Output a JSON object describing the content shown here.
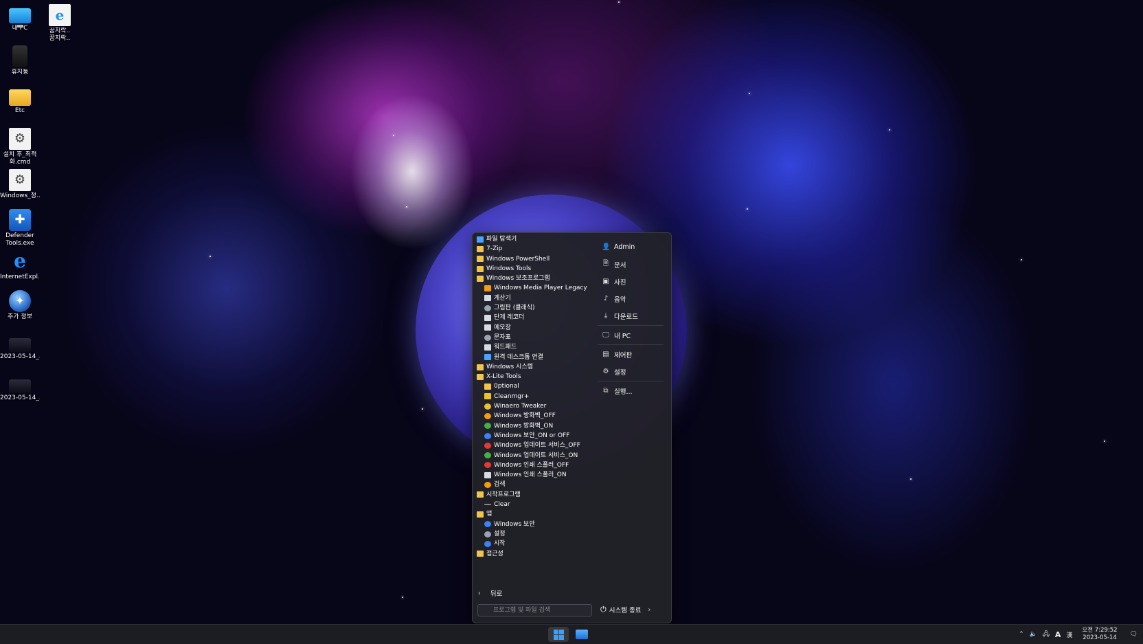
{
  "desktop": {
    "icons": [
      {
        "label": "내 PC",
        "icon": "monitor-icon"
      },
      {
        "label": "꿈지락.. 꿈지락..",
        "icon": "internet-explorer-icon"
      },
      {
        "label": "휴지통",
        "icon": "recycle-bin-icon"
      },
      {
        "label": "Etc",
        "icon": "folder-icon"
      },
      {
        "label": "설치 후_최적화.cmd",
        "icon": "gear-script-icon"
      },
      {
        "label": "Windows_정...",
        "icon": "gear-script-icon"
      },
      {
        "label": "Defender Tools.exe",
        "icon": "shield-icon"
      },
      {
        "label": "InternetExpl...",
        "icon": "internet-explorer-icon"
      },
      {
        "label": "추가 정보",
        "icon": "globe-icon"
      },
      {
        "label": "2023-05-14_...",
        "icon": "video-thumbnail-icon"
      },
      {
        "label": "2023-05-14_...",
        "icon": "video-thumbnail-icon"
      }
    ]
  },
  "start_menu": {
    "programs": [
      {
        "label": "파일 탐색기",
        "level": 0,
        "icon": "file-explorer-icon"
      },
      {
        "label": "7-Zip",
        "level": 0,
        "icon": "folder-icon"
      },
      {
        "label": "Windows PowerShell",
        "level": 0,
        "icon": "folder-icon"
      },
      {
        "label": "Windows Tools",
        "level": 0,
        "icon": "folder-icon"
      },
      {
        "label": "Windows 보조프로그램",
        "level": 0,
        "icon": "folder-icon"
      },
      {
        "label": "Windows Media Player Legacy",
        "level": 1,
        "icon": "media-player-icon"
      },
      {
        "label": "계산기",
        "level": 1,
        "icon": "calculator-icon"
      },
      {
        "label": "그림판 (클래식)",
        "level": 1,
        "icon": "paint-icon"
      },
      {
        "label": "단계 레코더",
        "level": 1,
        "icon": "steps-recorder-icon"
      },
      {
        "label": "메모장",
        "level": 1,
        "icon": "notepad-icon"
      },
      {
        "label": "문자표",
        "level": 1,
        "icon": "character-map-icon"
      },
      {
        "label": "워드패드",
        "level": 1,
        "icon": "wordpad-icon"
      },
      {
        "label": "원격 데스크톱 연결",
        "level": 1,
        "icon": "remote-desktop-icon"
      },
      {
        "label": "Windows 시스템",
        "level": 0,
        "icon": "folder-icon"
      },
      {
        "label": "X-Lite Tools",
        "level": 0,
        "icon": "folder-icon"
      },
      {
        "label": "0ptional",
        "level": 1,
        "icon": "folder-icon"
      },
      {
        "label": "Cleanmgr+",
        "level": 1,
        "icon": "broom-icon"
      },
      {
        "label": "Winaero Tweaker",
        "level": 1,
        "icon": "tweaker-icon"
      },
      {
        "label": "Windows 방화벽_OFF",
        "level": 1,
        "icon": "firewall-off-icon"
      },
      {
        "label": "Windows 방화벽_ON",
        "level": 1,
        "icon": "firewall-on-icon"
      },
      {
        "label": "Windows 보안_ON or OFF",
        "level": 1,
        "icon": "security-toggle-icon"
      },
      {
        "label": "Windows 업데이트 서비스_OFF",
        "level": 1,
        "icon": "update-off-icon"
      },
      {
        "label": "Windows 업데이트 서비스_ON",
        "level": 1,
        "icon": "update-on-icon"
      },
      {
        "label": "Windows 인쇄 스풀러_OFF",
        "level": 1,
        "icon": "spooler-off-icon"
      },
      {
        "label": "Windows 인쇄 스풀러_ON",
        "level": 1,
        "icon": "printer-icon"
      },
      {
        "label": "검색",
        "level": 1,
        "icon": "search-icon"
      },
      {
        "label": "시작프로그램",
        "level": 0,
        "icon": "folder-icon"
      },
      {
        "label": "Clear",
        "level": 1,
        "icon": "clear-icon"
      },
      {
        "label": "앱",
        "level": 0,
        "icon": "folder-icon"
      },
      {
        "label": "Windows 보안",
        "level": 1,
        "icon": "windows-security-icon"
      },
      {
        "label": "설정",
        "level": 1,
        "icon": "settings-icon"
      },
      {
        "label": "시작",
        "level": 1,
        "icon": "start-icon"
      },
      {
        "label": "접근성",
        "level": 0,
        "icon": "folder-icon"
      }
    ],
    "right_panel": [
      {
        "label": "Admin",
        "icon": "user-icon"
      },
      {
        "label": "문서",
        "icon": "document-icon"
      },
      {
        "label": "사진",
        "icon": "picture-icon"
      },
      {
        "label": "음악",
        "icon": "music-icon"
      },
      {
        "label": "다운로드",
        "icon": "download-icon"
      },
      {
        "label": "내 PC",
        "icon": "computer-icon"
      },
      {
        "label": "제어판",
        "icon": "control-panel-icon"
      },
      {
        "label": "설정",
        "icon": "gear-icon"
      },
      {
        "label": "실행...",
        "icon": "run-icon"
      }
    ],
    "back_label": "뒤로",
    "search_placeholder": "프로그램 및 파일 검색",
    "power_label": "시스템 종료"
  },
  "taskbar": {
    "tray": {
      "ime_label": "A",
      "ime_mode": "漢"
    },
    "clock": {
      "time": "오전 7:29:52",
      "date": "2023-05-14"
    }
  },
  "colors": {
    "accent": "#3aa0ff",
    "menu_bg": "#212128",
    "taskbar_bg": "#1c1d22"
  }
}
